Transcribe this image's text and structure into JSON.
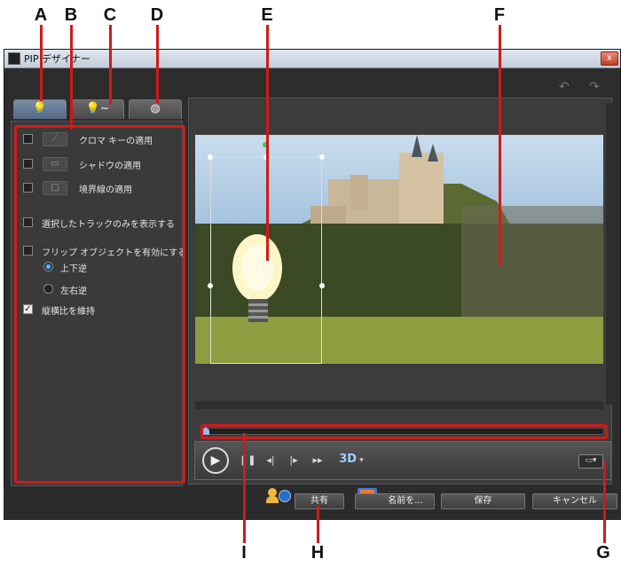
{
  "callouts": {
    "a": "A",
    "b": "B",
    "c": "C",
    "d": "D",
    "e": "E",
    "f": "F",
    "g": "G",
    "h": "H",
    "i": "I"
  },
  "window": {
    "title": "PIP デザイナー",
    "close": "x"
  },
  "tabs": [
    {
      "icon": "lightbulb-icon"
    },
    {
      "icon": "lightbulb-motion-icon"
    },
    {
      "icon": "globe-icon"
    }
  ],
  "options": {
    "chroma_key": "クロマ キーの適用",
    "shadow": "シャドウの適用",
    "border": "境界線の適用",
    "show_selected_track": "選択したトラックのみを表示する",
    "enable_flip": "フリップ オブジェクトを有効にする",
    "flip_vertical": "上下逆",
    "flip_horizontal": "左右逆",
    "keep_aspect": "縦横比を維持"
  },
  "option_states": {
    "chroma_key": false,
    "shadow": false,
    "border": false,
    "show_selected_track": false,
    "enable_flip": false,
    "flip_vertical": true,
    "flip_horizontal": false,
    "keep_aspect": true
  },
  "controls": {
    "three_d": "3D"
  },
  "buttons": {
    "share": "共有",
    "save_as": "名前を...",
    "save": "保存",
    "cancel": "キャンセル"
  },
  "colors": {
    "accent": "#d11a1a",
    "window_bg": "#2d2d2d"
  }
}
